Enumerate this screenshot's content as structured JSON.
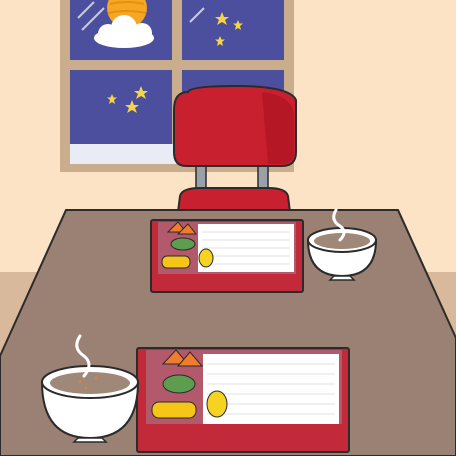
{
  "scene": {
    "kind": "illustration",
    "palette": {
      "wall": "#fde3c6",
      "wall_lower": "#d9b99b",
      "window_frame": "#c9ad8c",
      "night_sky": "#4b4f9e",
      "window_sill": "#e9ecf4",
      "moon": "#f5a623",
      "stars": "#f6d445",
      "chair": "#c8202f",
      "chair_legs": "#9aa0a8",
      "table": "#9b8173",
      "bento_box": "#c22a3a",
      "bento_inner": "#b2596c",
      "rice": "#ffffff",
      "egg": "#f6d321",
      "tamagoyaki": "#f5c518",
      "broccoli": "#5e9c4f",
      "carrot": "#f07d2d",
      "bowl": "#ffffff",
      "soup": "#a08878",
      "outline": "#2b2b2b"
    },
    "icons": [
      "window-icon",
      "moon-icon",
      "cloud-icon",
      "star-icon",
      "chair-icon",
      "table-icon",
      "bento-box-icon",
      "soup-bowl-icon",
      "steam-icon"
    ]
  }
}
